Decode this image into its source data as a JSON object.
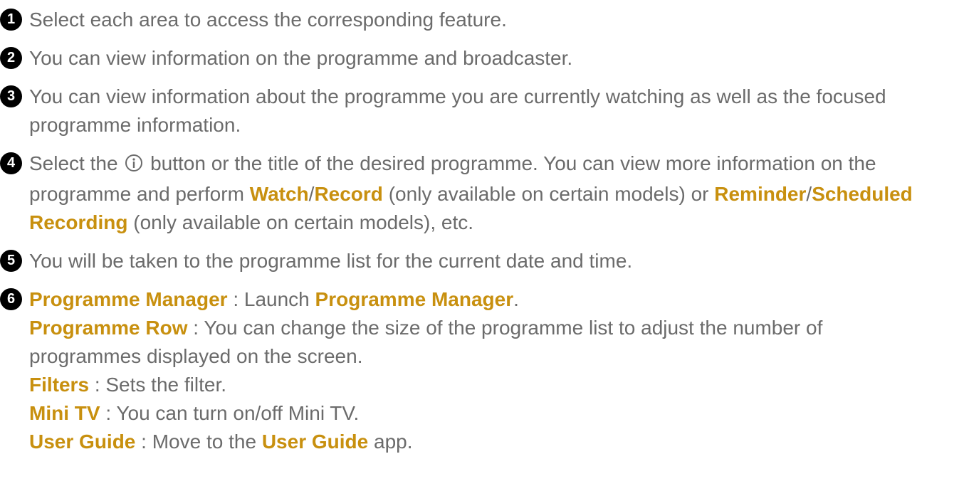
{
  "items": [
    {
      "number": "1",
      "text": "Select each area to access the corresponding feature."
    },
    {
      "number": "2",
      "text": "You can view information on the programme and broadcaster."
    },
    {
      "number": "3",
      "text": "You can view information about the programme you are currently watching as well as the focused programme information."
    },
    {
      "number": "4",
      "pre_icon": "Select the",
      "icon": "info-icon",
      "post_icon": "button or the title of the desired programme. You can view more information on the programme and perform",
      "watch": "Watch",
      "sep1": "/",
      "record": "Record",
      "certain_models_1": "(only available on certain models) or",
      "reminder": "Reminder",
      "sep2": "/",
      "scheduled_recording": "Scheduled Recording",
      "certain_models_2": "(only available on certain models), etc."
    },
    {
      "number": "5",
      "text": "You will be taken to the programme list for the current date and time."
    },
    {
      "number": "6",
      "programme_manager": {
        "label": "Programme Manager",
        "colon": ":",
        "desc": "Launch",
        "target": "Programme Manager",
        "end": "."
      },
      "programme_row": {
        "label": "Programme Row",
        "colon": ":",
        "desc": "You can change the size of the programme list to adjust the number of programmes displayed on the screen."
      },
      "filters": {
        "label": "Filters",
        "colon": ":",
        "desc": "Sets the filter."
      },
      "mini_tv": {
        "label": "Mini TV",
        "colon": ":",
        "desc": "You can turn on/off Mini TV."
      },
      "user_guide": {
        "label": "User Guide",
        "colon": ":",
        "desc": "Move to the",
        "target": "User Guide",
        "end": "app."
      }
    }
  ],
  "colors": {
    "highlight": "#c8900f",
    "text": "#6b6b6b",
    "badge": "#000000"
  }
}
